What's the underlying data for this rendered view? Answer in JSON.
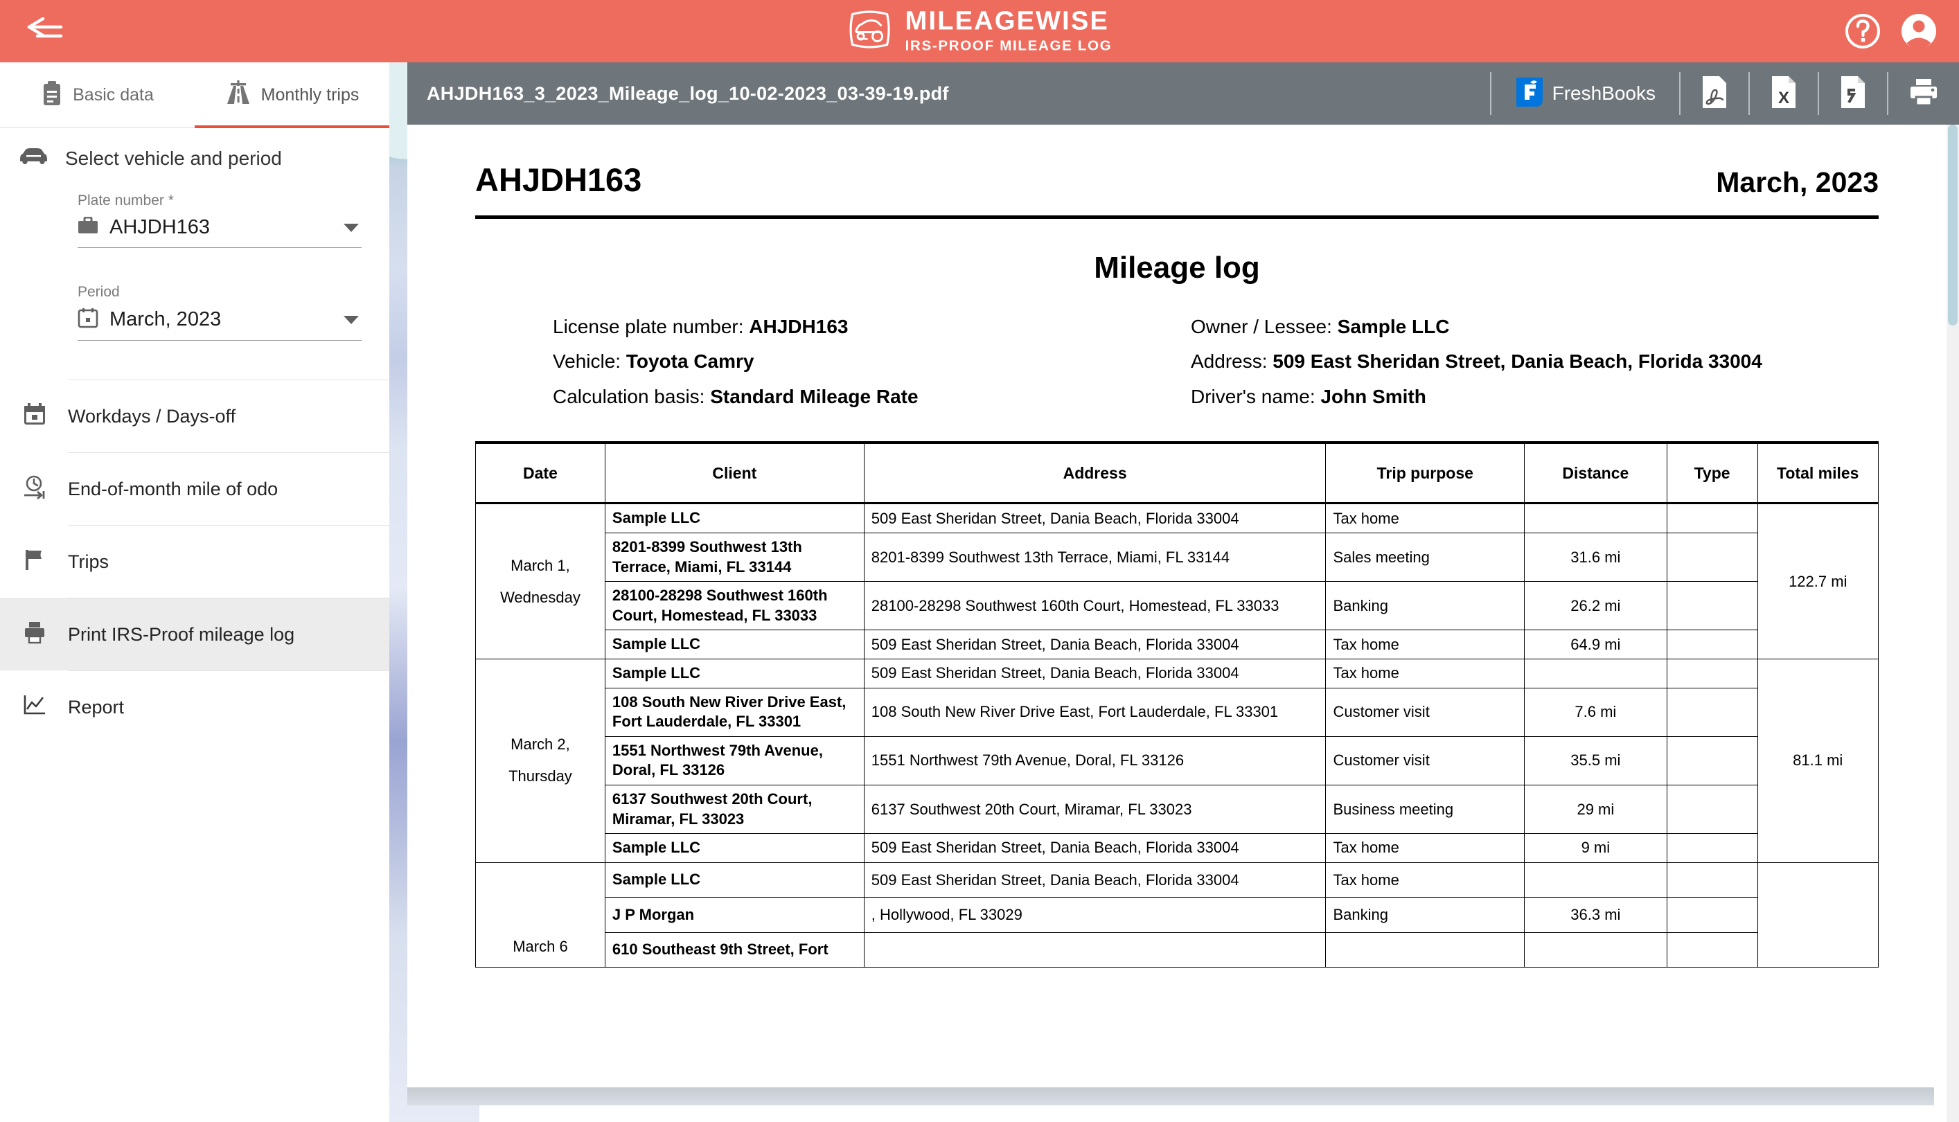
{
  "topbar": {
    "back_icon": "back-arrow-icon",
    "brand_title": "MILEAGEWISE",
    "brand_subtitle": "IRS-PROOF MILEAGE LOG",
    "help_icon": "help-circle-icon",
    "account_icon": "account-circle-icon"
  },
  "sidebar": {
    "tabs": [
      {
        "label": "Basic data",
        "icon": "clipboard-icon",
        "active": false
      },
      {
        "label": "Monthly trips",
        "icon": "highway-icon",
        "active": true
      }
    ],
    "section": {
      "icon": "car-icon",
      "title": "Select vehicle and period",
      "fields": [
        {
          "label": "Plate number *",
          "value": "AHJDH163",
          "icon": "briefcase-icon"
        },
        {
          "label": "Period",
          "value": "March, 2023",
          "icon": "calendar-icon"
        }
      ]
    },
    "menu": [
      {
        "label": "Workdays / Days-off",
        "icon": "calendar-icon",
        "active": false
      },
      {
        "label": "End-of-month mile of odo",
        "icon": "clock-arrow-icon",
        "active": false
      },
      {
        "label": "Trips",
        "icon": "flag-icon",
        "active": false
      },
      {
        "label": "Print IRS-Proof mileage log",
        "icon": "printer-icon",
        "active": true
      },
      {
        "label": "Report",
        "icon": "chart-line-icon",
        "active": false
      }
    ]
  },
  "viewer": {
    "filename": "AHJDH163_3_2023_Mileage_log_10-02-2023_03-39-19.pdf",
    "tools": [
      {
        "name": "freshbooks-export",
        "label": "FreshBooks",
        "icon": "freshbooks-icon"
      },
      {
        "name": "pdf-export",
        "label": "",
        "icon": "pdf-file-icon"
      },
      {
        "name": "excel-export",
        "label": "",
        "icon": "excel-file-icon"
      },
      {
        "name": "file-export",
        "label": "",
        "icon": "document-file-icon"
      },
      {
        "name": "print",
        "label": "",
        "icon": "printer-icon"
      }
    ]
  },
  "document": {
    "plate_header": "AHJDH163",
    "month_header": "March, 2023",
    "title": "Mileage log",
    "left_info": [
      {
        "label": "License plate number:",
        "value": "AHJDH163"
      },
      {
        "label": "Vehicle:",
        "value": "Toyota Camry"
      },
      {
        "label": "Calculation basis:",
        "value": "Standard Mileage Rate"
      }
    ],
    "right_info": [
      {
        "label": "Owner / Lessee:",
        "value": "Sample LLC"
      },
      {
        "label": "Address:",
        "value": "509 East Sheridan Street, Dania Beach, Florida 33004"
      },
      {
        "label": "Driver's name:",
        "value": "John Smith"
      }
    ],
    "table": {
      "columns": [
        "Date",
        "Client",
        "Address",
        "Trip purpose",
        "Distance",
        "Type",
        "Total miles"
      ],
      "groups": [
        {
          "date_line1": "March 1,",
          "date_line2": "Wednesday",
          "total": "122.7 mi",
          "rows": [
            {
              "client": "Sample LLC",
              "address": "509 East Sheridan Street, Dania Beach, Florida 33004",
              "purpose": "Tax home",
              "distance": "",
              "type": ""
            },
            {
              "client": "8201-8399 Southwest 13th Terrace, Miami, FL 33144",
              "address": "8201-8399 Southwest 13th Terrace, Miami, FL 33144",
              "purpose": "Sales meeting",
              "distance": "31.6 mi",
              "type": ""
            },
            {
              "client": "28100-28298 Southwest 160th Court, Homestead, FL 33033",
              "address": "28100-28298 Southwest 160th Court, Homestead, FL 33033",
              "purpose": "Banking",
              "distance": "26.2 mi",
              "type": ""
            },
            {
              "client": "Sample LLC",
              "address": "509 East Sheridan Street, Dania Beach, Florida 33004",
              "purpose": "Tax home",
              "distance": "64.9 mi",
              "type": ""
            }
          ]
        },
        {
          "date_line1": "March 2,",
          "date_line2": "Thursday",
          "total": "81.1 mi",
          "rows": [
            {
              "client": "Sample LLC",
              "address": "509 East Sheridan Street, Dania Beach, Florida 33004",
              "purpose": "Tax home",
              "distance": "",
              "type": ""
            },
            {
              "client": "108 South New River Drive East, Fort Lauderdale, FL 33301",
              "address": "108 South New River Drive East, Fort Lauderdale, FL 33301",
              "purpose": "Customer visit",
              "distance": "7.6 mi",
              "type": ""
            },
            {
              "client": "1551 Northwest 79th Avenue, Doral, FL 33126",
              "address": "1551 Northwest 79th Avenue, Doral, FL 33126",
              "purpose": "Customer visit",
              "distance": "35.5 mi",
              "type": ""
            },
            {
              "client": "6137 Southwest 20th Court, Miramar, FL 33023",
              "address": "6137 Southwest 20th Court, Miramar, FL 33023",
              "purpose": "Business meeting",
              "distance": "29 mi",
              "type": ""
            },
            {
              "client": "Sample LLC",
              "address": "509 East Sheridan Street, Dania Beach, Florida 33004",
              "purpose": "Tax home",
              "distance": "9 mi",
              "type": ""
            }
          ]
        },
        {
          "date_line1": "March 6",
          "date_line2": "",
          "total": "",
          "rows": [
            {
              "client": "Sample LLC",
              "address": "509 East Sheridan Street, Dania Beach, Florida 33004",
              "purpose": "Tax home",
              "distance": "",
              "type": ""
            },
            {
              "client": "J P Morgan",
              "address": ", Hollywood, FL 33029",
              "purpose": "Banking",
              "distance": "36.3 mi",
              "type": ""
            },
            {
              "client": "610 Southeast 9th Street, Fort",
              "address": "",
              "purpose": "",
              "distance": "",
              "type": ""
            }
          ]
        }
      ]
    }
  },
  "colors": {
    "brand": "#ee6c5e",
    "toolbar": "#6e757b",
    "accent_underline": "#e8503a"
  }
}
